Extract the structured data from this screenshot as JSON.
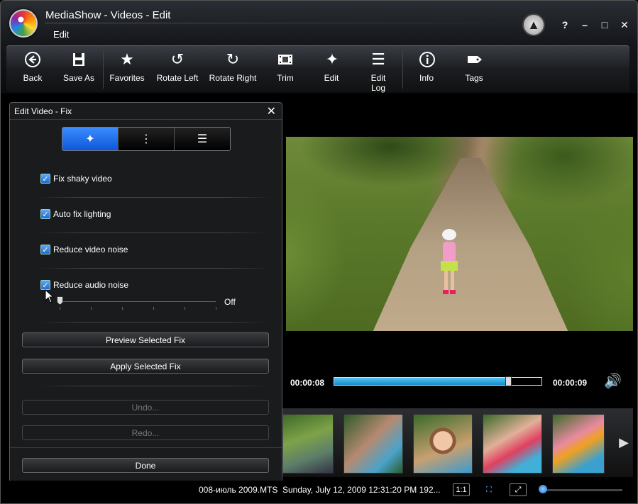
{
  "window": {
    "title": "MediaShow - Videos - Edit",
    "subtitle": "Edit",
    "help": "?",
    "minimize": "–",
    "maximize": "□",
    "close": "✕"
  },
  "toolbar": {
    "items": [
      {
        "label": "Back",
        "icon": "back-icon"
      },
      {
        "label": "Save As",
        "icon": "save-as-icon"
      },
      {
        "label": "Favorites",
        "icon": "star-icon"
      },
      {
        "label": "Rotate Left",
        "icon": "rotate-left-icon"
      },
      {
        "label": "Rotate Right",
        "icon": "rotate-right-icon"
      },
      {
        "label": "Trim",
        "icon": "film-icon"
      },
      {
        "label": "Edit",
        "icon": "magic-wand-icon"
      },
      {
        "label": "Edit Log",
        "icon": "checklist-icon"
      },
      {
        "label": "Info",
        "icon": "info-icon"
      },
      {
        "label": "Tags",
        "icon": "tag-icon"
      }
    ]
  },
  "panel": {
    "title": "Edit Video - Fix",
    "options": [
      {
        "label": "Fix shaky video",
        "checked": true
      },
      {
        "label": "Auto fix lighting",
        "checked": true
      },
      {
        "label": "Reduce video noise",
        "checked": true
      },
      {
        "label": "Reduce audio noise",
        "checked": true
      }
    ],
    "slider_value": "Off",
    "preview_label": "Preview Selected Fix",
    "apply_label": "Apply Selected Fix",
    "undo_label": "Undo...",
    "redo_label": "Redo...",
    "done_label": "Done"
  },
  "player": {
    "current_time": "00:00:08",
    "total_time": "00:00:09",
    "progress": 0.84
  },
  "status": {
    "filename": "008-июль 2009.MTS",
    "date": "Sunday, July 12, 2009 12:31:20 PM",
    "size": "192...",
    "ratio_label": "1:1"
  },
  "colors": {
    "accent": "#1e6fd8",
    "seek": "#29a3dc"
  }
}
